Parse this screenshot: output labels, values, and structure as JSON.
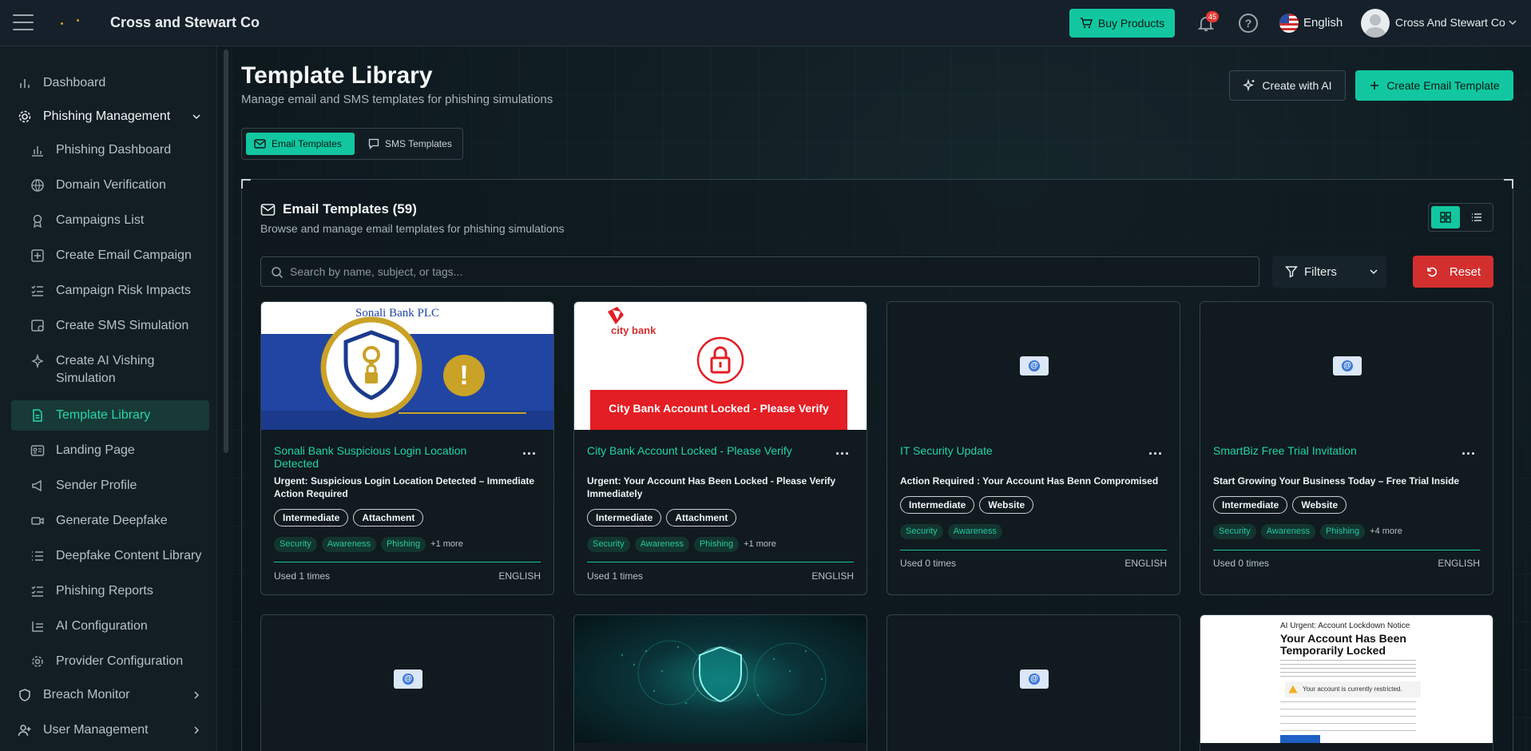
{
  "header": {
    "brand": "Cross and Stewart Co",
    "buy_label": "Buy Products",
    "notification_count": "45",
    "help_symbol": "?",
    "language": "English",
    "user_name": "Cross And Stewart Co"
  },
  "sidebar": {
    "dashboard": "Dashboard",
    "phishing_management": "Phishing Management",
    "items": [
      "Phishing Dashboard",
      "Domain Verification",
      "Campaigns List",
      "Create Email Campaign",
      "Campaign Risk Impacts",
      "Create SMS Simulation",
      "Create AI Vishing Simulation",
      "Template Library",
      "Landing Page",
      "Sender Profile",
      "Generate Deepfake",
      "Deepfake Content Library",
      "Phishing Reports",
      "AI Configuration",
      "Provider Configuration"
    ],
    "breach_monitor": "Breach Monitor",
    "user_management": "User Management"
  },
  "page": {
    "title": "Template Library",
    "subtitle": "Manage email and SMS templates for phishing simulations",
    "create_ai_label": "Create with AI",
    "create_email_label": "Create Email Template",
    "tabs": {
      "email": "Email Templates",
      "sms": "SMS Templates"
    }
  },
  "panel": {
    "title": "Email Templates (59)",
    "subtitle": "Browse and manage email templates for phishing simulations",
    "search_placeholder": "Search by name, subject, or tags...",
    "filters_label": "Filters",
    "reset_label": "Reset"
  },
  "thumbs": {
    "sonali_name": "Sonali Bank PLC",
    "sonali_alert": "!",
    "city_logo": "city bank",
    "city_banner": "City Bank Account Locked - Please Verify",
    "placeholder_symbol": "@",
    "lockdown_heading": "AI Urgent: Account Lockdown Notice",
    "lockdown_title": "Your Account Has Been Temporarily Locked",
    "lockdown_notice": "Your account is currently restricted."
  },
  "cards": [
    {
      "title": "Sonali Bank Suspicious Login Location Detected",
      "subject": "Urgent: Suspicious Login Location Detected – Immediate Action Required",
      "difficulty": "Intermediate",
      "type": "Attachment",
      "tags": [
        "Security",
        "Awareness",
        "Phishing"
      ],
      "more": "+1 more",
      "used": "Used 1 times",
      "language": "ENGLISH"
    },
    {
      "title": "City Bank Account Locked - Please Verify",
      "subject": "Urgent: Your Account Has Been Locked - Please Verify Immediately",
      "difficulty": "Intermediate",
      "type": "Attachment",
      "tags": [
        "Security",
        "Awareness",
        "Phishing"
      ],
      "more": "+1 more",
      "used": "Used 1 times",
      "language": "ENGLISH"
    },
    {
      "title": "IT Security Update",
      "subject": "Action Required : Your Account Has Benn Compromised",
      "difficulty": "Intermediate",
      "type": "Website",
      "tags": [
        "Security",
        "Awareness"
      ],
      "more": "",
      "used": "Used 0 times",
      "language": "ENGLISH"
    },
    {
      "title": "SmartBiz Free Trial Invitation",
      "subject": "Start Growing Your Business Today – Free Trial Inside",
      "difficulty": "Intermediate",
      "type": "Website",
      "tags": [
        "Security",
        "Awareness",
        "Phishing"
      ],
      "more": "+4 more",
      "used": "Used 0 times",
      "language": "ENGLISH"
    }
  ],
  "colors": {
    "accent": "#12c7a0",
    "danger": "#d32f2f",
    "background": "#0f1a1f"
  }
}
